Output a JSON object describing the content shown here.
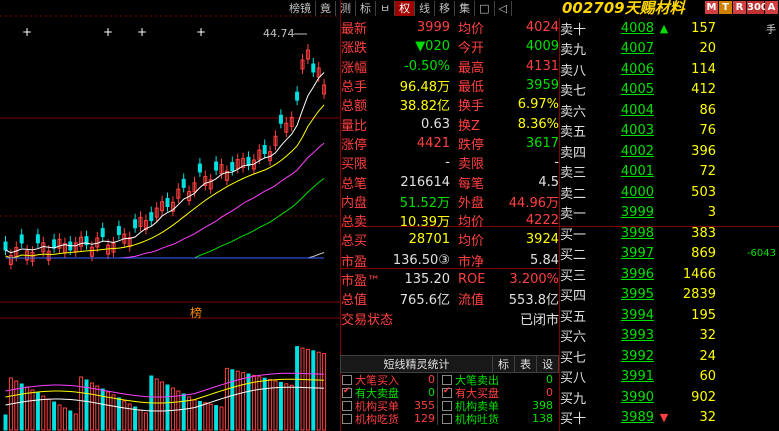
{
  "toolbar": {
    "items": [
      "榜镜",
      "竟",
      "测",
      "标",
      "ㅂ",
      "权",
      "线",
      "移",
      "集",
      "□",
      "◁"
    ],
    "highlight_index": 5
  },
  "stock": {
    "code": "002709",
    "name": "天赐材料"
  },
  "badges": [
    {
      "t": "M",
      "c": "#d04040"
    },
    {
      "t": "T",
      "c": "#d08000"
    },
    {
      "t": "R",
      "c": "#d04040"
    },
    {
      "t": "300",
      "c": "#c03030"
    },
    {
      "t": "A",
      "c": "#d04040"
    }
  ],
  "chart": {
    "peak_label": "44.74",
    "vol_title": "榜"
  },
  "quote": [
    {
      "l1": "最新",
      "v1": "3999",
      "c1": "red",
      "l2": "均价",
      "v2": "4024",
      "c2": "red"
    },
    {
      "l1": "涨跌",
      "v1": "▼020",
      "c1": "green",
      "l2": "今开",
      "v2": "4009",
      "c2": "green"
    },
    {
      "l1": "涨幅",
      "v1": "-0.50%",
      "c1": "green",
      "l2": "最高",
      "v2": "4131",
      "c2": "red"
    },
    {
      "l1": "总手",
      "v1": "96.48万",
      "c1": "yellow",
      "l2": "最低",
      "v2": "3959",
      "c2": "green"
    },
    {
      "l1": "总额",
      "v1": "38.82亿",
      "c1": "yellow",
      "l2": "换手",
      "v2": "6.97%",
      "c2": "yellow"
    },
    {
      "l1": "量比",
      "v1": "0.63",
      "c1": "white",
      "l2": "换Z",
      "v2": "8.36%",
      "c2": "yellow"
    },
    {
      "l1": "涨停",
      "v1": "4421",
      "c1": "red",
      "l2": "跌停",
      "v2": "3617",
      "c2": "green"
    },
    {
      "l1": "买限",
      "v1": "-",
      "c1": "white",
      "l2": "卖限",
      "v2": "-",
      "c2": "white"
    },
    {
      "l1": "总笔",
      "v1": "216614",
      "c1": "white",
      "l2": "每笔",
      "v2": "4.5",
      "c2": "white"
    },
    {
      "l1": "内盘",
      "v1": "51.52万",
      "c1": "green",
      "l2": "外盘",
      "v2": "44.96万",
      "c2": "red"
    }
  ],
  "quote2": [
    {
      "l1": "总卖",
      "v1": "10.39万",
      "c1": "yellow",
      "l2": "均价",
      "v2": "4222",
      "c2": "red"
    },
    {
      "l1": "总买",
      "v1": "28701",
      "c1": "yellow",
      "l2": "均价",
      "v2": "3924",
      "c2": "yellow"
    }
  ],
  "quote3": [
    {
      "l1": "市盈",
      "v1": "136.50③",
      "c1": "white",
      "l2": "市净",
      "v2": "5.84",
      "c2": "white"
    },
    {
      "l1": "市盈™",
      "v1": "135.20",
      "c1": "white",
      "l2": "ROE",
      "v2": "3.200%",
      "c2": "red"
    },
    {
      "l1": "总值",
      "v1": "765.6亿",
      "c1": "white",
      "l2": "流值",
      "v2": "553.8亿",
      "c2": "white"
    },
    {
      "l1": "交易状态",
      "v1": "",
      "c1": "white",
      "l2": "",
      "v2": "已闭市",
      "c2": "white"
    }
  ],
  "sells": [
    {
      "lab": "卖十",
      "price": "4008",
      "vol": "157",
      "ext": "手",
      "arrow": "▲"
    },
    {
      "lab": "卖九",
      "price": "4007",
      "vol": "20",
      "ext": "",
      "arrow": ""
    },
    {
      "lab": "卖八",
      "price": "4006",
      "vol": "114",
      "ext": "",
      "arrow": ""
    },
    {
      "lab": "卖七",
      "price": "4005",
      "vol": "412",
      "ext": "",
      "arrow": ""
    },
    {
      "lab": "卖六",
      "price": "4004",
      "vol": "86",
      "ext": "",
      "arrow": ""
    },
    {
      "lab": "卖五",
      "price": "4003",
      "vol": "76",
      "ext": "",
      "arrow": ""
    },
    {
      "lab": "卖四",
      "price": "4002",
      "vol": "396",
      "ext": "",
      "arrow": ""
    },
    {
      "lab": "卖三",
      "price": "4001",
      "vol": "72",
      "ext": "",
      "arrow": ""
    },
    {
      "lab": "卖二",
      "price": "4000",
      "vol": "503",
      "ext": "",
      "arrow": ""
    },
    {
      "lab": "卖一",
      "price": "3999",
      "vol": "3",
      "ext": "",
      "arrow": ""
    }
  ],
  "buys": [
    {
      "lab": "买一",
      "price": "3998",
      "vol": "383",
      "ext": "",
      "arrow": ""
    },
    {
      "lab": "买二",
      "price": "3997",
      "vol": "869",
      "ext": "-6043",
      "arrow": ""
    },
    {
      "lab": "买三",
      "price": "3996",
      "vol": "1466",
      "ext": "",
      "arrow": ""
    },
    {
      "lab": "买四",
      "price": "3995",
      "vol": "2839",
      "ext": "",
      "arrow": ""
    },
    {
      "lab": "买五",
      "price": "3994",
      "vol": "195",
      "ext": "",
      "arrow": ""
    },
    {
      "lab": "买六",
      "price": "3993",
      "vol": "32",
      "ext": "",
      "arrow": ""
    },
    {
      "lab": "买七",
      "price": "3992",
      "vol": "24",
      "ext": "",
      "arrow": ""
    },
    {
      "lab": "买八",
      "price": "3991",
      "vol": "60",
      "ext": "",
      "arrow": ""
    },
    {
      "lab": "买九",
      "price": "3990",
      "vol": "902",
      "ext": "",
      "arrow": ""
    },
    {
      "lab": "买十",
      "price": "3989",
      "vol": "32",
      "ext": "",
      "arrow": "▼"
    }
  ],
  "spirit": {
    "title": "短线精灵统计",
    "tabs": [
      "标",
      "表",
      "设"
    ],
    "rows": [
      {
        "a": "大笔买入",
        "an": "0",
        "ac": "red",
        "ao": false,
        "b": "大笔卖出",
        "bn": "0",
        "bc": "green",
        "bo": false
      },
      {
        "a": "有大卖盘",
        "an": "0",
        "ac": "green",
        "ao": true,
        "b": "有大买盘",
        "bn": "0",
        "bc": "red",
        "bo": true
      },
      {
        "a": "机构买单",
        "an": "355",
        "ac": "red",
        "ao": false,
        "b": "机构卖单",
        "bn": "398",
        "bc": "green",
        "bo": false
      },
      {
        "a": "机构吃货",
        "an": "129",
        "ac": "red",
        "ao": false,
        "b": "机构吐货",
        "bn": "138",
        "bc": "green",
        "bo": false
      }
    ]
  },
  "colors": {
    "up": "#ff4040",
    "down": "#00e000",
    "bg": "#000000",
    "grid": "#800000"
  }
}
